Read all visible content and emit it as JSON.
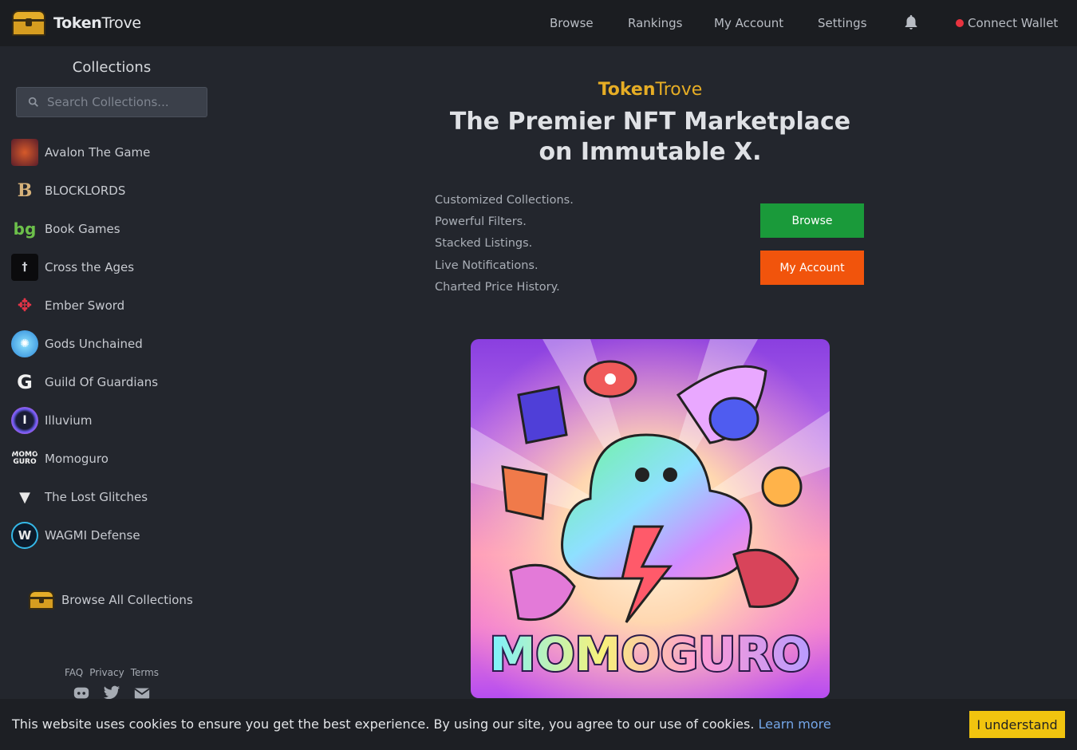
{
  "header": {
    "brand_bold": "Token",
    "brand_rest": "Trove",
    "nav": [
      "Browse",
      "Rankings",
      "My Account",
      "Settings"
    ],
    "wallet_label": "Connect Wallet",
    "wallet_status_color": "#e8333f"
  },
  "sidebar": {
    "title": "Collections",
    "search_placeholder": "Search Collections...",
    "collections": [
      {
        "label": "Avalon The Game",
        "icon": "avalon-icon"
      },
      {
        "label": "BLOCKLORDS",
        "icon": "blocklords-icon"
      },
      {
        "label": "Book Games",
        "icon": "book-games-icon"
      },
      {
        "label": "Cross the Ages",
        "icon": "cross-the-ages-icon"
      },
      {
        "label": "Ember Sword",
        "icon": "ember-sword-icon"
      },
      {
        "label": "Gods Unchained",
        "icon": "gods-unchained-icon"
      },
      {
        "label": "Guild Of Guardians",
        "icon": "guild-of-guardians-icon"
      },
      {
        "label": "Illuvium",
        "icon": "illuvium-icon"
      },
      {
        "label": "Momoguro",
        "icon": "momoguro-icon"
      },
      {
        "label": "The Lost Glitches",
        "icon": "lost-glitches-icon"
      },
      {
        "label": "WAGMI Defense",
        "icon": "wagmi-defense-icon"
      }
    ],
    "browse_all": "Browse All Collections",
    "footer_links": [
      "FAQ",
      "Privacy",
      "Terms"
    ]
  },
  "hero": {
    "brand_bold": "Token",
    "brand_rest": "Trove",
    "title": "The Premier NFT Marketplace on Immutable X.",
    "features": [
      "Customized Collections.",
      "Powerful Filters.",
      "Stacked Listings.",
      "Live Notifications.",
      "Charted Price History."
    ],
    "browse_button": "Browse",
    "account_button": "My Account",
    "showcase_logo": "MOMOGURO"
  },
  "cookie": {
    "text": "This website uses cookies to ensure you get the best experience. By using our site, you agree to our use of cookies.",
    "link": "Learn more",
    "button": "I understand"
  },
  "colors": {
    "accent": "#e6ad25",
    "browse_green": "#1a9a3a",
    "account_orange": "#f1540c",
    "cookie_button": "#f1c40f"
  }
}
